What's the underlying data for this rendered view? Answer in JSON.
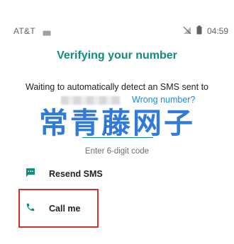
{
  "status_bar": {
    "carrier": "AT&T",
    "time": "04:59"
  },
  "screen": {
    "title": "Verifying your number",
    "info_line": "Waiting to automatically detect an SMS sent to",
    "wrong_number_link": "Wrong number?",
    "code_hint": "Enter 6-digit code",
    "watermark": "常青藤网子"
  },
  "actions": {
    "resend_sms": "Resend SMS",
    "call_me": "Call me"
  },
  "colors": {
    "accent": "#128c7e",
    "link": "#1e88e5",
    "highlight": "#d32f2f"
  }
}
